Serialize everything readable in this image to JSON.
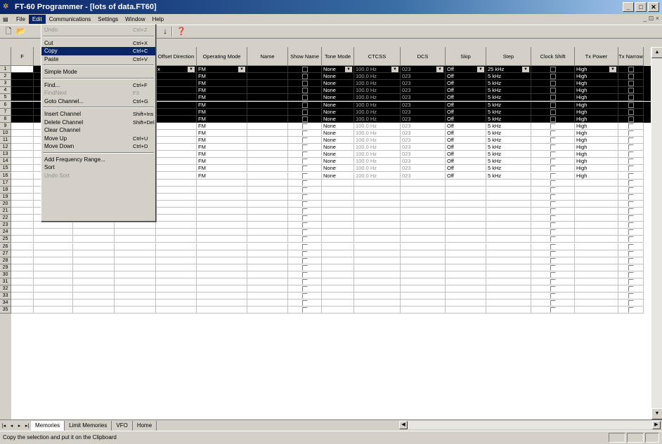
{
  "window": {
    "title": "FT-60 Programmer - [lots of data.FT60]",
    "min": "_",
    "max": "□",
    "close": "✕"
  },
  "menubar": [
    "File",
    "Edit",
    "Communications",
    "Settings",
    "Window",
    "Help"
  ],
  "mdi_controls": "_ ⊡ ×",
  "toolbar_icons": [
    "new-icon",
    "open-icon",
    "sort-icon",
    "help-icon"
  ],
  "columns": [
    "Offset Direction",
    "Operating Mode",
    "Name",
    "Show Name",
    "Tone Mode",
    "CTCSS",
    "DCS",
    "Skip",
    "Step",
    "Clock Shift",
    "Tx Power",
    "Tx Narrow"
  ],
  "first_col_header": "F",
  "first_cell_values": {
    "freq_prefix": "",
    "offset_val": "x"
  },
  "rows_data": [
    {
      "n": "1",
      "mode": "FM",
      "tone": "None",
      "ctcss": "100.0 Hz",
      "dcs": "023",
      "skip": "Off",
      "step": "25 kHz",
      "power": "High"
    },
    {
      "n": "2",
      "mode": "FM",
      "tone": "None",
      "ctcss": "100.0 Hz",
      "dcs": "023",
      "skip": "Off",
      "step": "5 kHz",
      "power": "High"
    },
    {
      "n": "3",
      "mode": "FM",
      "tone": "None",
      "ctcss": "100.0 Hz",
      "dcs": "023",
      "skip": "Off",
      "step": "5 kHz",
      "power": "High"
    },
    {
      "n": "4",
      "mode": "FM",
      "tone": "None",
      "ctcss": "100.0 Hz",
      "dcs": "023",
      "skip": "Off",
      "step": "5 kHz",
      "power": "High"
    },
    {
      "n": "5",
      "mode": "FM",
      "tone": "None",
      "ctcss": "100.0 Hz",
      "dcs": "023",
      "skip": "Off",
      "step": "5 kHz",
      "power": "High"
    },
    {
      "n": "6",
      "mode": "FM",
      "tone": "None",
      "ctcss": "100.0 Hz",
      "dcs": "023",
      "skip": "Off",
      "step": "5 kHz",
      "power": "High"
    },
    {
      "n": "7",
      "mode": "FM",
      "tone": "None",
      "ctcss": "100.0 Hz",
      "dcs": "023",
      "skip": "Off",
      "step": "5 kHz",
      "power": "High"
    },
    {
      "n": "8",
      "mode": "FM",
      "tone": "None",
      "ctcss": "100.0 Hz",
      "dcs": "023",
      "skip": "Off",
      "step": "5 kHz",
      "power": "High"
    },
    {
      "n": "9",
      "mode": "FM",
      "tone": "None",
      "ctcss": "100.0 Hz",
      "dcs": "023",
      "skip": "Off",
      "step": "5 kHz",
      "power": "High"
    },
    {
      "n": "10",
      "mode": "FM",
      "tone": "None",
      "ctcss": "100.0 Hz",
      "dcs": "023",
      "skip": "Off",
      "step": "5 kHz",
      "power": "High"
    },
    {
      "n": "11",
      "mode": "FM",
      "tone": "None",
      "ctcss": "100.0 Hz",
      "dcs": "023",
      "skip": "Off",
      "step": "5 kHz",
      "power": "High"
    },
    {
      "n": "12",
      "mode": "FM",
      "tone": "None",
      "ctcss": "100.0 Hz",
      "dcs": "023",
      "skip": "Off",
      "step": "5 kHz",
      "power": "High"
    },
    {
      "n": "13",
      "mode": "FM",
      "tone": "None",
      "ctcss": "100.0 Hz",
      "dcs": "023",
      "skip": "Off",
      "step": "5 kHz",
      "power": "High"
    },
    {
      "n": "14",
      "mode": "FM",
      "tone": "None",
      "ctcss": "100.0 Hz",
      "dcs": "023",
      "skip": "Off",
      "step": "5 kHz",
      "power": "High"
    },
    {
      "n": "15",
      "mode": "FM",
      "tone": "None",
      "ctcss": "100.0 Hz",
      "dcs": "023",
      "skip": "Off",
      "step": "5 kHz",
      "power": "High"
    },
    {
      "n": "16",
      "mode": "FM",
      "tone": "None",
      "ctcss": "100.0 Hz",
      "dcs": "023",
      "skip": "Off",
      "step": "5 kHz",
      "power": "High"
    }
  ],
  "empty_rows": [
    "17",
    "18",
    "19",
    "20",
    "21",
    "22",
    "23",
    "24",
    "25",
    "26",
    "27",
    "28",
    "29",
    "30",
    "31",
    "32",
    "33",
    "34",
    "35"
  ],
  "selected_rows": 8,
  "tabs": [
    "Memories",
    "Limit Memories",
    "VFO",
    "Home"
  ],
  "active_tab": "Memories",
  "tab_nav": [
    "|◂",
    "◂",
    "▸",
    "▸|"
  ],
  "status": "Copy the selection and put it on the Clipboard",
  "edit_menu": [
    {
      "label": "Undo",
      "shortcut": "Ctrl+Z",
      "disabled": true
    },
    {
      "sep": true
    },
    {
      "label": "Cut",
      "shortcut": "Ctrl+X"
    },
    {
      "label": "Copy",
      "shortcut": "Ctrl+C",
      "highlight": true
    },
    {
      "label": "Paste",
      "shortcut": "Ctrl+V"
    },
    {
      "sep": true
    },
    {
      "label": "Simple Mode",
      "shortcut": ""
    },
    {
      "sep": true
    },
    {
      "label": "Find...",
      "shortcut": "Ctrl+F"
    },
    {
      "label": "FindNext",
      "shortcut": "F3",
      "disabled": true
    },
    {
      "label": "Goto Channel...",
      "shortcut": "Ctrl+G"
    },
    {
      "sep": true
    },
    {
      "label": "Insert Channel",
      "shortcut": "Shift+Ins"
    },
    {
      "label": "Delete Channel",
      "shortcut": "Shift+Del"
    },
    {
      "label": "Clear Channel",
      "shortcut": ""
    },
    {
      "label": "Move Up",
      "shortcut": "Ctrl+U"
    },
    {
      "label": "Move Down",
      "shortcut": "Ctrl+D"
    },
    {
      "sep": true
    },
    {
      "label": "Add Frequency Range...",
      "shortcut": ""
    },
    {
      "label": "Sort",
      "shortcut": ""
    },
    {
      "label": "Undo Sort",
      "shortcut": "",
      "disabled": true
    }
  ],
  "colors": {
    "title_start": "#0a246a",
    "selection": "#000000",
    "menu_highlight": "#0a246a",
    "face": "#d4d0c8"
  }
}
